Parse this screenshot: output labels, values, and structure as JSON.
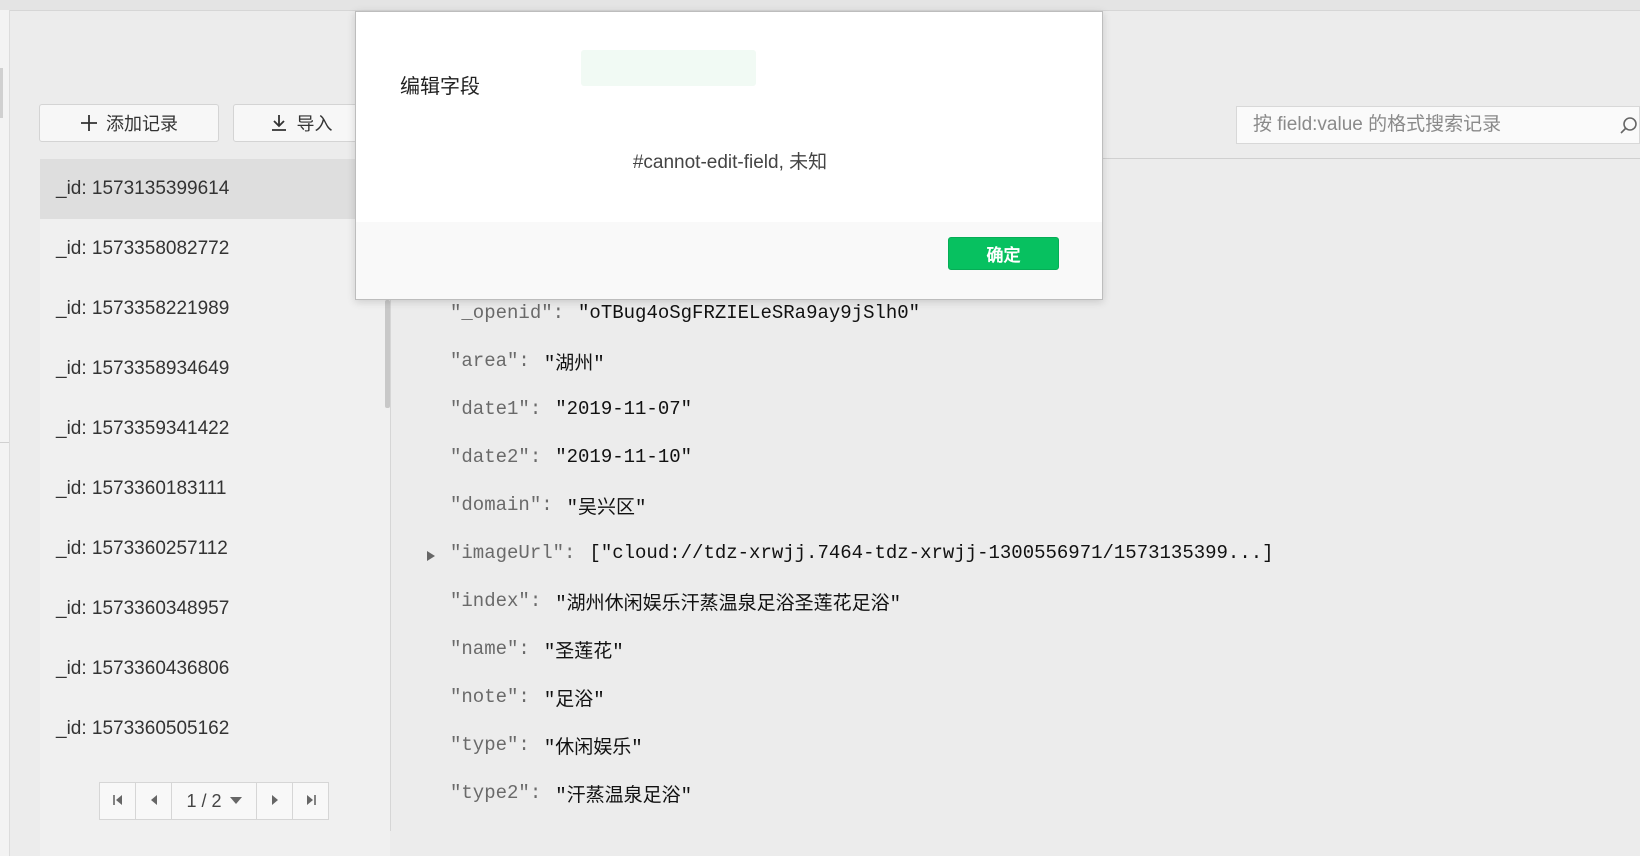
{
  "toolbar": {
    "add_record_label": "添加记录",
    "import_label": "导入"
  },
  "search": {
    "placeholder": "按 field:value 的格式搜索记录"
  },
  "records": [
    {
      "label": "_id: 1573135399614"
    },
    {
      "label": "_id: 1573358082772"
    },
    {
      "label": "_id: 1573358221989"
    },
    {
      "label": "_id: 1573358934649"
    },
    {
      "label": "_id: 1573359341422"
    },
    {
      "label": "_id: 1573360183111"
    },
    {
      "label": "_id: 1573360257112"
    },
    {
      "label": "_id: 1573360348957"
    },
    {
      "label": "_id: 1573360436806"
    },
    {
      "label": "_id: 1573360505162"
    }
  ],
  "pager": {
    "page_label": "1 / 2"
  },
  "fields": [
    {
      "key": "\"_openid\":",
      "value": "\"oTBug4oSgFRZIELeSRa9ay9jSlh0\""
    },
    {
      "key": "\"area\":",
      "value": "\"湖州\""
    },
    {
      "key": "\"date1\":",
      "value": "\"2019-11-07\""
    },
    {
      "key": "\"date2\":",
      "value": "\"2019-11-10\""
    },
    {
      "key": "\"domain\":",
      "value": "\"吴兴区\""
    },
    {
      "key": "\"imageUrl\":",
      "value": "[\"cloud://tdz-xrwjj.7464-tdz-xrwjj-1300556971/1573135399...]"
    },
    {
      "key": "\"index\":",
      "value": "\"湖州休闲娱乐汗蒸温泉足浴圣莲花足浴\""
    },
    {
      "key": "\"name\":",
      "value": "\"圣莲花\""
    },
    {
      "key": "\"note\":",
      "value": "\"足浴\""
    },
    {
      "key": "\"type\":",
      "value": "\"休闲娱乐\""
    },
    {
      "key": "\"type2\":",
      "value": "\"汗蒸温泉足浴\""
    }
  ],
  "modal": {
    "title": "编辑字段",
    "message": "#cannot-edit-field, 未知",
    "ok_label": "确定"
  },
  "colors": {
    "accent": "#07c160",
    "selected_row": "#dedede"
  },
  "icons": {
    "add": "plus-icon",
    "import": "download-icon",
    "search": "search-icon",
    "first": "first-page-icon",
    "prev": "prev-page-icon",
    "next": "next-page-icon",
    "last": "last-page-icon",
    "dropdown": "caret-down-icon",
    "expand": "expand-triangle-icon"
  }
}
